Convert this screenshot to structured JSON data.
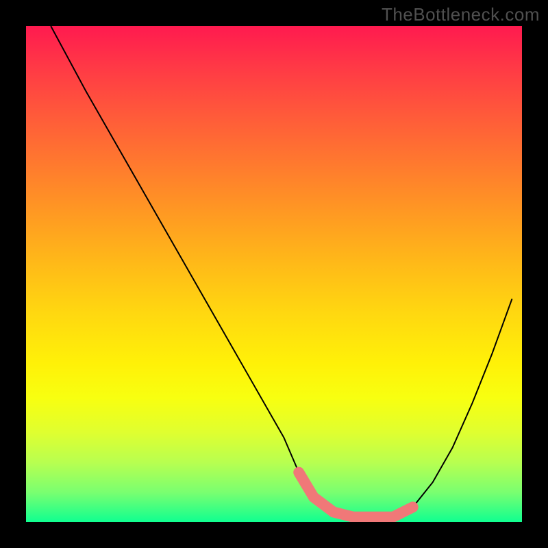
{
  "watermark": "TheBottleneck.com",
  "chart_data": {
    "type": "line",
    "title": "",
    "xlabel": "",
    "ylabel": "",
    "xlim": [
      0,
      100
    ],
    "ylim": [
      0,
      100
    ],
    "series": [
      {
        "name": "curve",
        "color": "#000000",
        "x": [
          5,
          12,
          20,
          28,
          36,
          44,
          52,
          55,
          58,
          62,
          66,
          70,
          74,
          78,
          82,
          86,
          90,
          94,
          98
        ],
        "values": [
          100,
          87,
          73,
          59,
          45,
          31,
          17,
          10,
          5,
          2,
          1,
          1,
          1,
          3,
          8,
          15,
          24,
          34,
          45
        ]
      },
      {
        "name": "highlight-band",
        "color": "#f07878",
        "x": [
          55,
          58,
          62,
          66,
          70,
          74,
          78
        ],
        "values": [
          10,
          5,
          2,
          1,
          1,
          1,
          3
        ]
      }
    ],
    "gradient_colors": {
      "top": "#ff1a4f",
      "mid1": "#ff9a22",
      "mid2": "#fff108",
      "bottom": "#10ff90"
    }
  }
}
